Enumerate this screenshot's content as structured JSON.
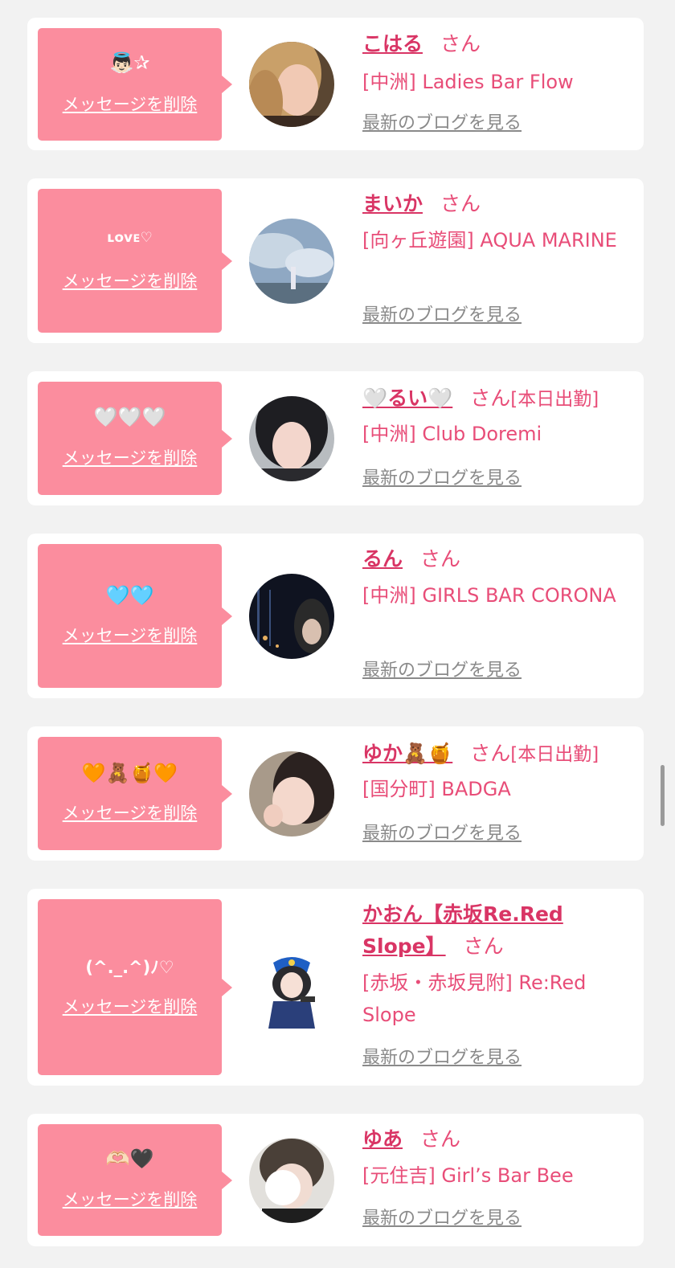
{
  "common": {
    "delete_label": "メッセージを削除",
    "san_label": "さん",
    "blog_label": "最新のブログを見る"
  },
  "colors": {
    "bubble": "#fb8d9e",
    "accent": "#e84d78",
    "link": "#d93565",
    "muted": "#8a8a8a",
    "background": "#f2f2f2"
  },
  "items": [
    {
      "message": "👼🏻✰",
      "name": "こはる",
      "status": "",
      "shop": "[中洲] Ladies Bar Flow"
    },
    {
      "message": "ʟᴏᴠᴇ♡",
      "name": "まいか",
      "status": "",
      "shop": "[向ヶ丘遊園] AQUA MARINE"
    },
    {
      "message": "🤍🤍🤍",
      "name": "🤍るい🤍",
      "status": "[本日出勤]",
      "shop": "[中洲] Club Doremi"
    },
    {
      "message": "🩵🩵",
      "name": "るん",
      "status": "",
      "shop": "[中洲] GIRLS BAR CORONA"
    },
    {
      "message": "🧡🧸🍯🧡",
      "name": "ゆか🧸🍯",
      "status": "[本日出勤]",
      "shop": "[国分町] BADGA"
    },
    {
      "message": "(^._.^)ﾉ♡",
      "name": "かおん【赤坂Re.Red Slope】",
      "status": "",
      "shop": "[赤坂・赤坂見附] Re:Red Slope"
    },
    {
      "message": "🫶🏻🖤",
      "name": "ゆあ",
      "status": "",
      "shop": "[元住吉] Girl’s Bar Bee"
    }
  ]
}
